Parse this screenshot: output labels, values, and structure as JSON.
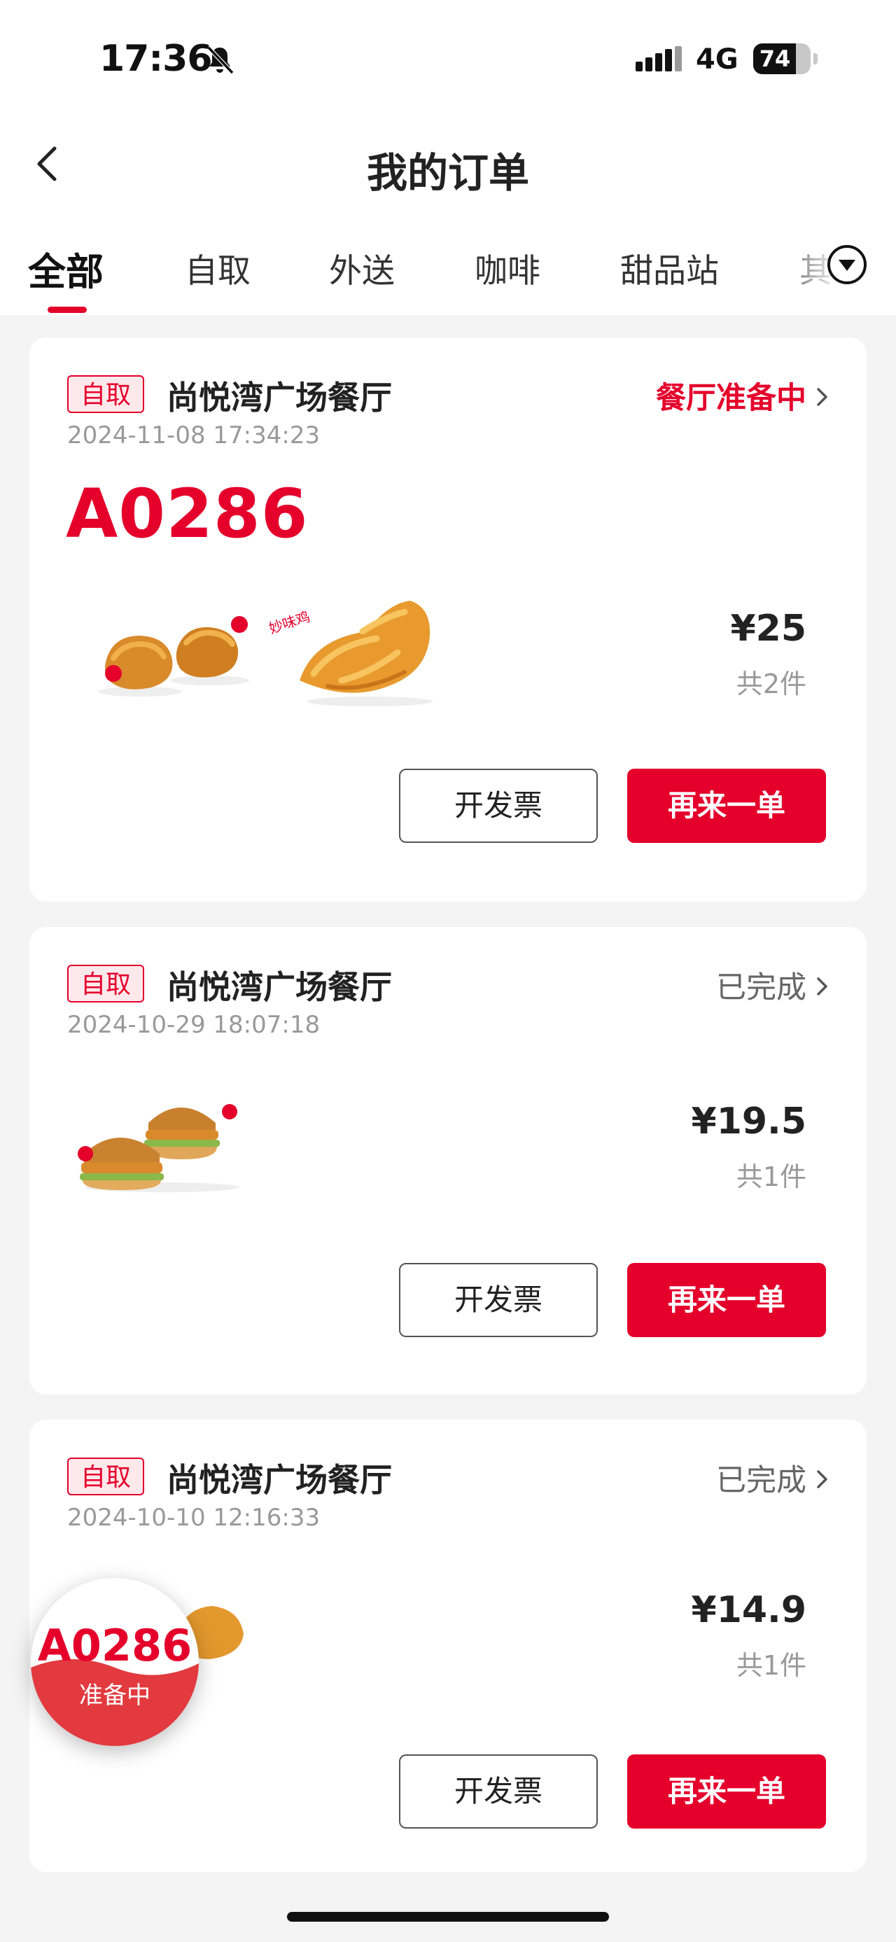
{
  "status_bar": {
    "time": "17:36",
    "network": "4G",
    "battery": "74",
    "battery_level": 0.74
  },
  "header": {
    "title": "我的订单"
  },
  "tabs": [
    {
      "label": "全部",
      "active": true
    },
    {
      "label": "自取"
    },
    {
      "label": "外送"
    },
    {
      "label": "咖啡"
    },
    {
      "label": "甜品站"
    },
    {
      "label": "其"
    }
  ],
  "orders": [
    {
      "type_badge": "自取",
      "store": "尚悦湾广场餐厅",
      "status": "餐厅准备中",
      "datetime": "2024-11-08 17:34:23",
      "pickup_code": "A0286",
      "price": "¥25",
      "count": "共2件",
      "invoice_label": "开发票",
      "reorder_label": "再来一单",
      "items": [
        "fried-chicken-nuggets",
        "crispy-chicken-wing"
      ]
    },
    {
      "type_badge": "自取",
      "store": "尚悦湾广场餐厅",
      "status": "已完成",
      "datetime": "2024-10-29 18:07:18",
      "price": "¥19.5",
      "count": "共1件",
      "invoice_label": "开发票",
      "reorder_label": "再来一单",
      "items": [
        "chicken-burger-pair"
      ]
    },
    {
      "type_badge": "自取",
      "store": "尚悦湾广场餐厅",
      "status": "已完成",
      "datetime": "2024-10-10 12:16:33",
      "price": "¥14.9",
      "count": "共1件",
      "invoice_label": "开发票",
      "reorder_label": "再来一单",
      "items": [
        "fried-chicken"
      ]
    }
  ],
  "floating": {
    "code": "A0286",
    "status": "准备中"
  },
  "colors": {
    "brand_red": "#e4002b",
    "bg": "#f4f4f4"
  }
}
